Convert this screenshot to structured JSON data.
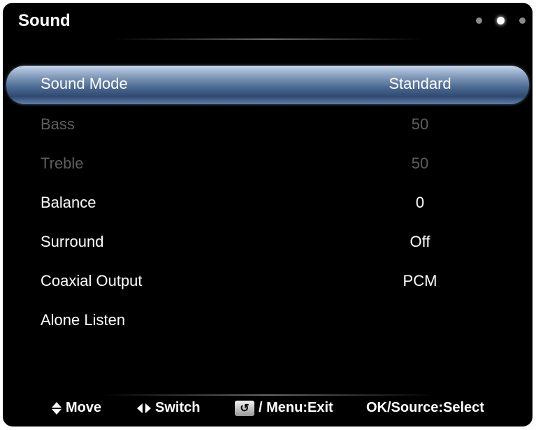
{
  "menu": {
    "title": "Sound",
    "page_indicator": {
      "total": 3,
      "active_index": 1
    },
    "items": [
      {
        "label": "Sound Mode",
        "value": "Standard",
        "state": "selected"
      },
      {
        "label": "Bass",
        "value": "50",
        "state": "disabled"
      },
      {
        "label": "Treble",
        "value": "50",
        "state": "disabled"
      },
      {
        "label": "Balance",
        "value": "0",
        "state": "normal"
      },
      {
        "label": "Surround",
        "value": "Off",
        "state": "normal"
      },
      {
        "label": "Coaxial Output",
        "value": "PCM",
        "state": "normal"
      },
      {
        "label": "Alone Listen",
        "value": "",
        "state": "normal"
      }
    ]
  },
  "footer": {
    "move": {
      "icon": "up-down-arrows-icon",
      "label": "Move"
    },
    "switch": {
      "icon": "left-right-arrows-icon",
      "label": "Switch"
    },
    "exit": {
      "icon": "return-icon",
      "label": "/ Menu:Exit"
    },
    "select": {
      "label": "OK/Source:Select"
    }
  },
  "colors": {
    "background": "#000000",
    "highlight": "#4d6b93",
    "text": "#ffffff",
    "disabled_text": "#5e5e5e"
  }
}
